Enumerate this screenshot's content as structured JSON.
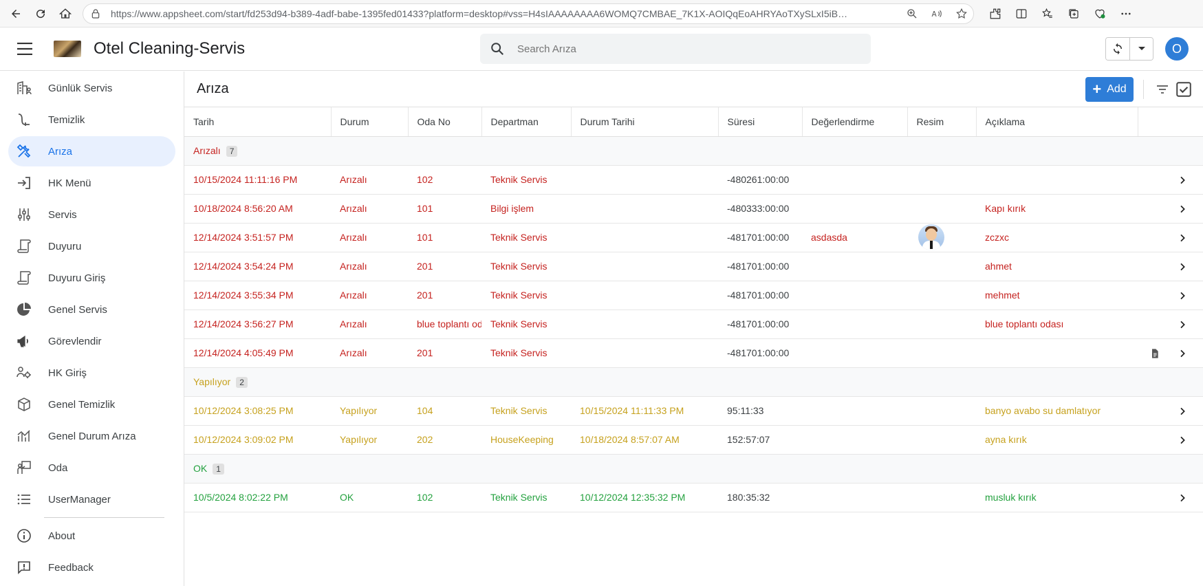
{
  "browser": {
    "url": "https://www.appsheet.com/start/fd253d94-b389-4adf-babe-1395fed01433?platform=desktop#vss=H4sIAAAAAAAA6WOMQ7CMBAE_7K1X-AOIQqEoAHRYAoTXySLxI5iBwiWH8..."
  },
  "header": {
    "app_title": "Otel Cleaning-Servis",
    "search_placeholder": "Search Arıza",
    "avatar_initial": "O"
  },
  "sidebar": {
    "items": [
      {
        "label": "Günlük Servis",
        "icon": "building-people-icon"
      },
      {
        "label": "Temizlik",
        "icon": "vacuum-icon"
      },
      {
        "label": "Arıza",
        "icon": "tools-icon"
      },
      {
        "label": "HK Menü",
        "icon": "sign-in-icon"
      },
      {
        "label": "Servis",
        "icon": "sliders-icon"
      },
      {
        "label": "Duyuru",
        "icon": "scroll-icon"
      },
      {
        "label": "Duyuru Giriş",
        "icon": "scroll-icon"
      },
      {
        "label": "Genel Servis",
        "icon": "pie-chart-icon"
      },
      {
        "label": "Görevlendir",
        "icon": "megaphone-icon"
      },
      {
        "label": "HK Giriş",
        "icon": "users-gear-icon"
      },
      {
        "label": "Genel Temizlik",
        "icon": "cube-icon"
      },
      {
        "label": "Genel Durum Arıza",
        "icon": "chart-icon"
      },
      {
        "label": "Oda",
        "icon": "teacher-icon"
      },
      {
        "label": "UserManager",
        "icon": "list-icon"
      }
    ],
    "footer_items": [
      {
        "label": "About",
        "icon": "info-icon"
      },
      {
        "label": "Feedback",
        "icon": "feedback-icon"
      }
    ]
  },
  "main": {
    "title": "Arıza",
    "add_label": "Add",
    "columns": [
      "Tarih",
      "Durum",
      "Oda No",
      "Departman",
      "Durum Tarihi",
      "Süresi",
      "Değerlendirme",
      "Resim",
      "Açıklama"
    ],
    "groups": [
      {
        "name": "Arızalı",
        "count": "7",
        "color": "#c5221f",
        "rows": [
          {
            "tarih": "10/15/2024 11:11:16 PM",
            "durum": "Arızalı",
            "oda": "102",
            "departman": "Teknik Servis",
            "durum_tarihi": "",
            "suresi": "-480261:00:00",
            "degerlendirme": "",
            "resim": false,
            "aciklama": "",
            "doc": false
          },
          {
            "tarih": "10/18/2024 8:56:20 AM",
            "durum": "Arızalı",
            "oda": "101",
            "departman": "Bilgi işlem",
            "durum_tarihi": "",
            "suresi": "-480333:00:00",
            "degerlendirme": "",
            "resim": false,
            "aciklama": "Kapı kırık",
            "doc": false
          },
          {
            "tarih": "12/14/2024 3:51:57 PM",
            "durum": "Arızalı",
            "oda": "101",
            "departman": "Teknik Servis",
            "durum_tarihi": "",
            "suresi": "-481701:00:00",
            "degerlendirme": "asdasda",
            "resim": true,
            "aciklama": "zczxc",
            "doc": false
          },
          {
            "tarih": "12/14/2024 3:54:24 PM",
            "durum": "Arızalı",
            "oda": "201",
            "departman": "Teknik Servis",
            "durum_tarihi": "",
            "suresi": "-481701:00:00",
            "degerlendirme": "",
            "resim": false,
            "aciklama": "ahmet",
            "doc": false
          },
          {
            "tarih": "12/14/2024 3:55:34 PM",
            "durum": "Arızalı",
            "oda": "201",
            "departman": "Teknik Servis",
            "durum_tarihi": "",
            "suresi": "-481701:00:00",
            "degerlendirme": "",
            "resim": false,
            "aciklama": "mehmet",
            "doc": false
          },
          {
            "tarih": "12/14/2024 3:56:27 PM",
            "durum": "Arızalı",
            "oda": "blue toplantı odası",
            "departman": "Teknik Servis",
            "durum_tarihi": "",
            "suresi": "-481701:00:00",
            "degerlendirme": "",
            "resim": false,
            "aciklama": "blue toplantı odası",
            "doc": false
          },
          {
            "tarih": "12/14/2024 4:05:49 PM",
            "durum": "Arızalı",
            "oda": "201",
            "departman": "Teknik Servis",
            "durum_tarihi": "",
            "suresi": "-481701:00:00",
            "degerlendirme": "",
            "resim": false,
            "aciklama": "",
            "doc": true
          }
        ]
      },
      {
        "name": "Yapılıyor",
        "count": "2",
        "color": "#c6a11d",
        "rows": [
          {
            "tarih": "10/12/2024 3:08:25 PM",
            "durum": "Yapılıyor",
            "oda": "104",
            "departman": "Teknik Servis",
            "durum_tarihi": "10/15/2024 11:11:33 PM",
            "suresi": "95:11:33",
            "degerlendirme": "",
            "resim": false,
            "aciklama": "banyo avabo su damlatıyor",
            "doc": false
          },
          {
            "tarih": "10/12/2024 3:09:02 PM",
            "durum": "Yapılıyor",
            "oda": "202",
            "departman": "HouseKeeping",
            "durum_tarihi": "10/18/2024 8:57:07 AM",
            "suresi": "152:57:07",
            "degerlendirme": "",
            "resim": false,
            "aciklama": "ayna kırık",
            "doc": false
          }
        ]
      },
      {
        "name": "OK",
        "count": "1",
        "color": "#23a13e",
        "rows": [
          {
            "tarih": "10/5/2024 8:02:22 PM",
            "durum": "OK",
            "oda": "102",
            "departman": "Teknik Servis",
            "durum_tarihi": "10/12/2024 12:35:32 PM",
            "suresi": "180:35:32",
            "degerlendirme": "",
            "resim": false,
            "aciklama": "musluk kırık",
            "doc": false
          }
        ]
      }
    ]
  }
}
